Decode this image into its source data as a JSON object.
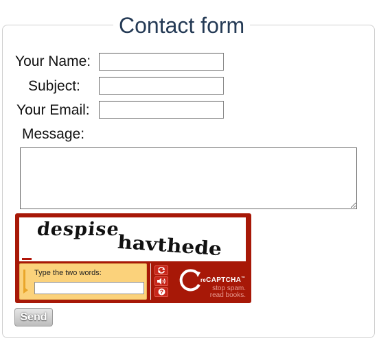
{
  "form": {
    "title": "Contact form",
    "fields": {
      "name_label": "Your Name:",
      "subject_label": "Subject:",
      "email_label": "Your Email:",
      "message_label": "Message:"
    },
    "send_label": "Send"
  },
  "captcha": {
    "word1": "despise",
    "word2": "havthede",
    "prompt": "Type the two words:",
    "brand": "CAPTCHA",
    "brand_prefix": "re",
    "tagline_1": "stop spam.",
    "tagline_2": "read books.",
    "reload_icon": "refresh-icon",
    "audio_icon": "audio-icon",
    "help_icon": "help-icon",
    "accent": "#a71807"
  }
}
